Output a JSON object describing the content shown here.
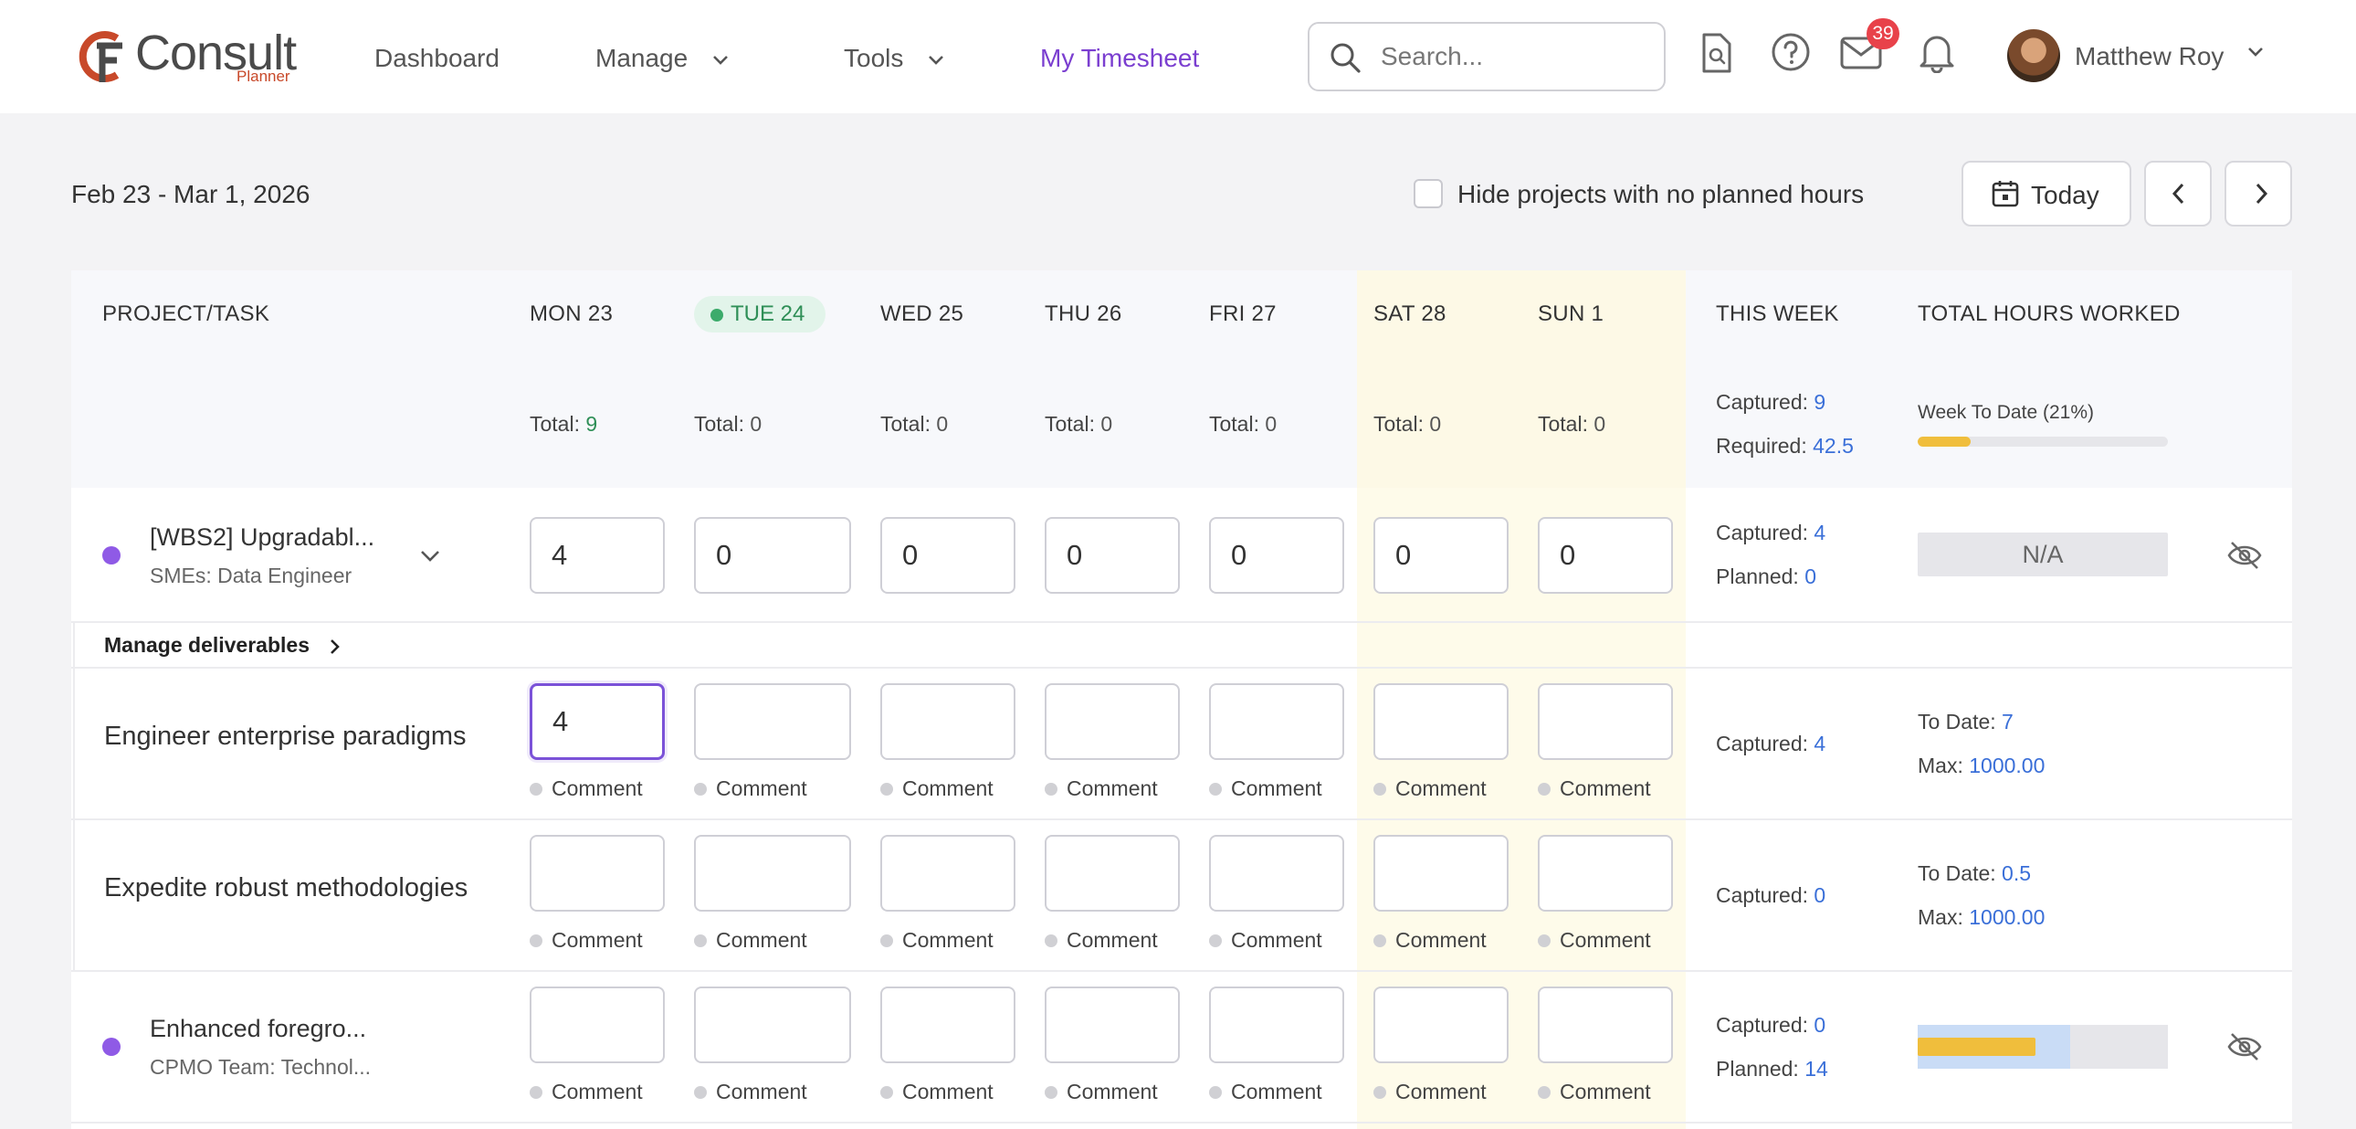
{
  "logo": {
    "word": "Consult",
    "sub": "Planner"
  },
  "nav": {
    "dashboard": "Dashboard",
    "manage": "Manage",
    "tools": "Tools",
    "timesheet": "My Timesheet"
  },
  "search": {
    "placeholder": "Search..."
  },
  "notifications": {
    "mail_count": "39"
  },
  "user": {
    "name": "Matthew Roy"
  },
  "toolbar": {
    "date_range": "Feb 23 - Mar 1, 2026",
    "hide_label": "Hide projects with no planned hours",
    "hide_checked": false,
    "today_label": "Today"
  },
  "table": {
    "headers": {
      "project": "PROJECT/TASK",
      "mon": "MON 23",
      "tue": "TUE 24",
      "wed": "WED 25",
      "thu": "THU 26",
      "fri": "FRI 27",
      "sat": "SAT 28",
      "sun": "SUN 1",
      "this_week": "THIS WEEK",
      "total_hours": "TOTAL HOURS WORKED"
    },
    "totals_label": "Total:",
    "totals": [
      "9",
      "0",
      "0",
      "0",
      "0",
      "0",
      "0"
    ],
    "summary": {
      "captured_label": "Captured:",
      "captured": "9",
      "required_label": "Required:",
      "required": "42.5",
      "week_to_date": "Week To Date (21%)",
      "week_to_date_pct": 21
    },
    "manage_deliverables": "Manage deliverables",
    "comment_label": "Comment",
    "planned_label": "Planned:",
    "to_date_label": "To Date:",
    "max_label": "Max:",
    "rows": [
      {
        "title": "[WBS2] Upgradabl...",
        "subtitle": "SMEs: Data Engineer",
        "values": [
          "4",
          "0",
          "0",
          "0",
          "0",
          "0",
          "0"
        ],
        "captured": "4",
        "planned": "0",
        "total_status": "N/A"
      },
      {
        "task": "Engineer enterprise paradigms",
        "values": [
          "4",
          "",
          "",
          "",
          "",
          "",
          ""
        ],
        "captured": "4",
        "to_date": "7",
        "max": "1000.00"
      },
      {
        "task": "Expedite robust methodologies",
        "values": [
          "",
          "",
          "",
          "",
          "",
          "",
          ""
        ],
        "captured": "0",
        "to_date": "0.5",
        "max": "1000.00"
      },
      {
        "title": "Enhanced foregro...",
        "subtitle": "CPMO Team: Technol...",
        "values": [
          "",
          "",
          "",
          "",
          "",
          "",
          ""
        ],
        "captured": "0",
        "planned": "14",
        "planned_fill": 0.61,
        "worked_fill": 0.47
      }
    ]
  },
  "colors": {
    "accent": "#7b3fd0",
    "link_blue": "#3a6fd8",
    "today_green": "#2f8f57",
    "weekend": "#fefbea",
    "progress_yellow": "#f0be3c"
  }
}
